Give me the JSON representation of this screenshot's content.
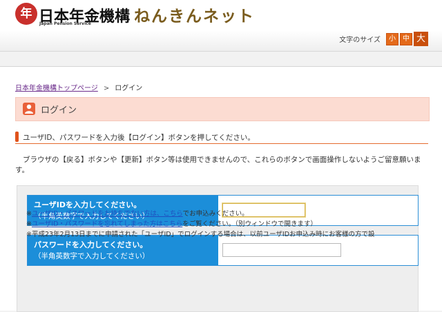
{
  "header": {
    "logo_mark": "年",
    "logo_text": "日本年金機構",
    "logo_sub": "Japan Pension Service",
    "site_title": "ねんきんネット",
    "font_size_label": "文字のサイズ",
    "font_sizes": [
      "小",
      "中",
      "大"
    ]
  },
  "breadcrumb": {
    "home_link": "日本年金機構トップページ",
    "separator": ">",
    "current": "ログイン"
  },
  "page": {
    "title": "ログイン",
    "instruction": "ユーザID、パスワードを入力後【ログイン】ボタンを押してください。",
    "notice": "ブラウザの【戻る】ボタンや【更新】ボタン等は使用できませんので、これらのボタンで画面操作しないようご留意願います。"
  },
  "form": {
    "user_id": {
      "label": "ユーザIDを入力してください。",
      "hint": "（半角英数字で入力してください）",
      "value": ""
    },
    "password": {
      "label": "パスワードを入力してください。",
      "hint": "（半角英数字で入力してください）",
      "value": ""
    }
  },
  "notes": {
    "n1_prefix": "※",
    "n1_link": "ユーザID・パスワードをお持ちでない方は、こちら",
    "n1_suffix": "でお申込みください。",
    "n2_prefix": "※",
    "n2_link": "ユーザID・パスワードを忘れてしまった方はこちら",
    "n2_suffix": "をご覧ください。（別ウィンドウで開きます）",
    "n3": "※平成23年2月13日までに申請された「ユーザID」でログインする場合は、以前ユーザIDお申込み時にお客様の方で設"
  },
  "colors": {
    "accent": "#e46a1a",
    "field_label_bg": "#1c8ed9",
    "title_bar_bg": "#fcdcd2"
  }
}
